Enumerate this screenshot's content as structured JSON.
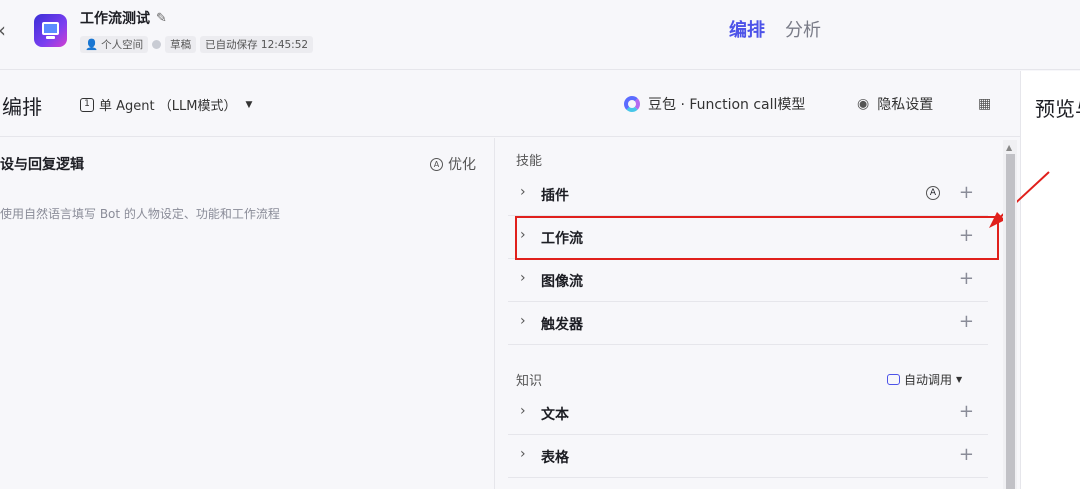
{
  "header": {
    "app_title": "工作流测试",
    "space": "个人空间",
    "draft": "草稿",
    "autosave": "已自动保存 12:45:52",
    "tabs": [
      "编排",
      "分析"
    ]
  },
  "toolbar": {
    "title": "编排",
    "mode": "单 Agent （LLM模式）",
    "model": "豆包 · Function call模型",
    "privacy": "隐私设置"
  },
  "preview": {
    "title": "预览与"
  },
  "prompt": {
    "title": "设与回复逻辑",
    "optimize": "优化",
    "placeholder": "使用自然语言填写 Bot 的人物设定、功能和工作流程"
  },
  "skills": {
    "label": "技能",
    "items": [
      "插件",
      "工作流",
      "图像流",
      "触发器"
    ]
  },
  "knowledge": {
    "label": "知识",
    "auto_call": "自动调用",
    "items": [
      "文本",
      "表格"
    ]
  },
  "colors": {
    "accent": "#4d53e8",
    "highlight": "#e0201c"
  }
}
